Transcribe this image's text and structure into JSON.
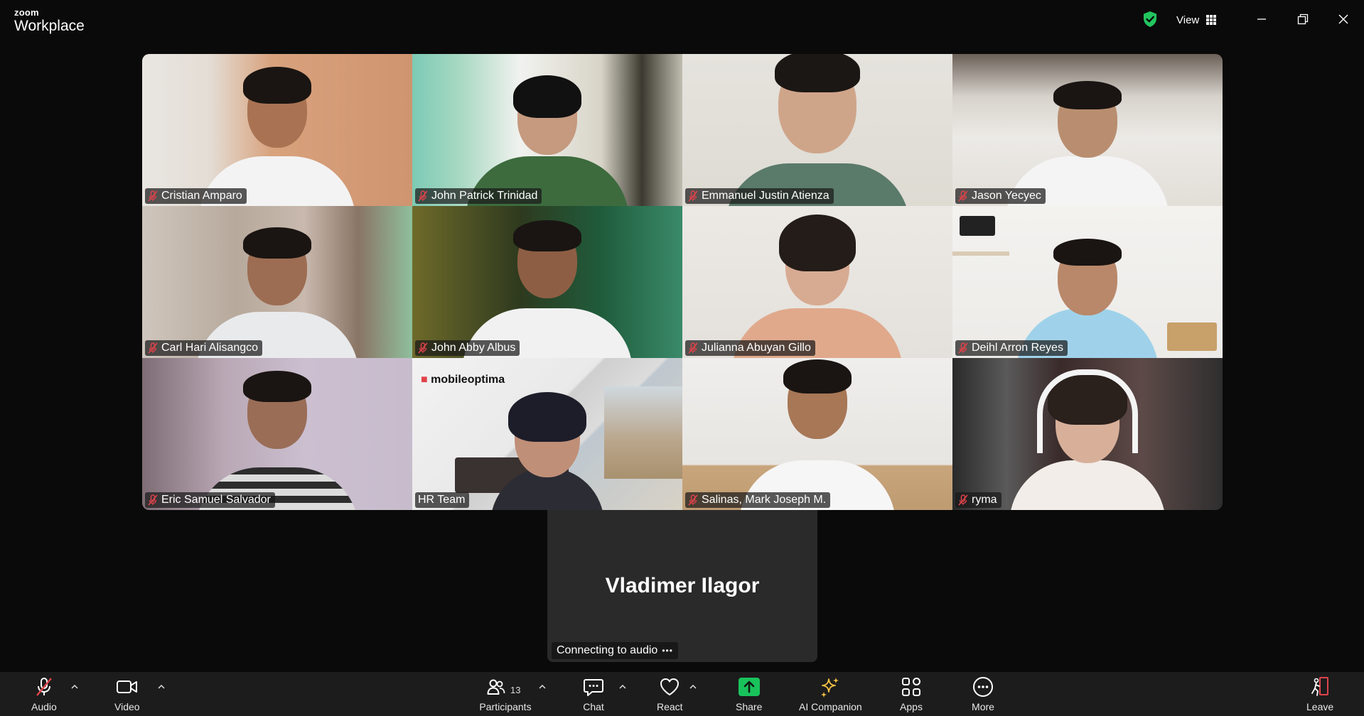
{
  "titlebar": {
    "brand_top": "zoom",
    "brand_bottom": "Workplace",
    "view_label": "View"
  },
  "participants": [
    {
      "name": "Cristian Amparo",
      "muted": true
    },
    {
      "name": "John Patrick Trinidad",
      "muted": true
    },
    {
      "name": "Emmanuel Justin Atienza",
      "muted": true
    },
    {
      "name": "Jason Yecyec",
      "muted": true
    },
    {
      "name": "Carl Hari Alisangco",
      "muted": true
    },
    {
      "name": "John Abby Albus",
      "muted": true
    },
    {
      "name": "Julianna Abuyan Gillo",
      "muted": true
    },
    {
      "name": "Deihl Arron Reyes",
      "muted": true
    },
    {
      "name": "Eric Samuel Salvador",
      "muted": true
    },
    {
      "name": "HR Team",
      "muted": false,
      "active_speaker": true,
      "logo_text": "mobileoptima"
    },
    {
      "name": "Salinas, Mark Joseph M.",
      "muted": true
    },
    {
      "name": "ryma",
      "muted": true
    }
  ],
  "connecting": {
    "name": "Vladimer Ilagor",
    "status": "Connecting to audio"
  },
  "toolbar": {
    "audio": "Audio",
    "video": "Video",
    "participants": "Participants",
    "participants_count": "13",
    "chat": "Chat",
    "react": "React",
    "share": "Share",
    "ai_companion": "AI Companion",
    "apps": "Apps",
    "more": "More",
    "leave": "Leave"
  },
  "colors": {
    "active_speaker": "#2ec95c",
    "share": "#19c35b",
    "shield": "#22c55e",
    "muted_red": "#e0434b",
    "leave": "#e0434b",
    "ai_companion": "#f5c044"
  }
}
